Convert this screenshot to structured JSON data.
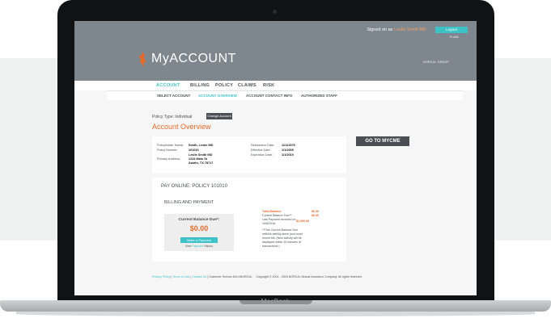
{
  "device": {
    "brand": "MacBook"
  },
  "header": {
    "signed_in_prefix": "Signed on as",
    "user_name": "Leslie Smith MD",
    "logout_label": "Logout",
    "profile_label": "Profile",
    "logo_text": "MyACCOUNT",
    "company_logo": "NORCAL GROUP"
  },
  "nav": {
    "primary": [
      "ACCOUNT",
      "BILLING",
      "POLICY",
      "CLAIMS",
      "RISK"
    ],
    "secondary": [
      "SELECT ACCOUNT",
      "ACCOUNT OVERVIEW",
      "ACCOUNT CONTACT INFO",
      "AUTHORIZED STAFF"
    ]
  },
  "overview": {
    "policy_type": "Policy Type: Individual",
    "change_account_label": "Change Account",
    "title": "Account Overview",
    "policyholder_label": "Policyholder Name:",
    "policyholder_value": "Smith, Leslie MD",
    "policy_number_label": "Policy Number:",
    "policy_number_value": "101010",
    "primary_address_label": "Primary Address:",
    "address_line1": "Leslie Smith MD",
    "address_line2": "1234 Main St",
    "address_line3": "Austin, TX 78717",
    "retro_label": "Retroactive Date:",
    "retro_value": "11/1/1975",
    "effective_label": "Effective Date:",
    "effective_value": "1/1/2005",
    "expiration_label": "Expiration Date:",
    "expiration_value": "1/1/2019",
    "go_mycme_label": "GO TO MYCME"
  },
  "pay": {
    "title": "PAY ONLINE: POLICY 101010",
    "billing_title": "BILLING AND PAYMENT",
    "current_balance_label": "Current Balance Due*:",
    "current_balance_value": "$0.00",
    "make_payment_label": "Make a Payment",
    "history_prefix": "View",
    "history_link": "Payment",
    "history_suffix": "History",
    "total_balance_label": "Total Balance:",
    "total_balance_value": "$0.00",
    "current_balance_row_label": "Current Balance Due**:",
    "current_balance_row_value": "$0.00",
    "last_payment_label": "Last Payment received on",
    "last_payment_date": "10/8/2018:",
    "last_payment_value": "$1,000.00",
    "note": "**This Current Balance Due reflects activity since your most recent bill. (New activity will be displayed within 15 minutes of transactions.)"
  },
  "footer": {
    "privacy": "Privacy Policy",
    "terms": "Terms of Use",
    "contact": "Contact Us",
    "service": "Customer Service 844.4NORCAL",
    "copyright": "Copyright © 2001 - 2018 NORCAL Mutual Insurance Company. All rights reserved."
  },
  "colors": {
    "accent": "#3fc2c7",
    "orange": "#e66a2c",
    "header_gray": "#7e868e",
    "dark": "#4b4f53"
  }
}
